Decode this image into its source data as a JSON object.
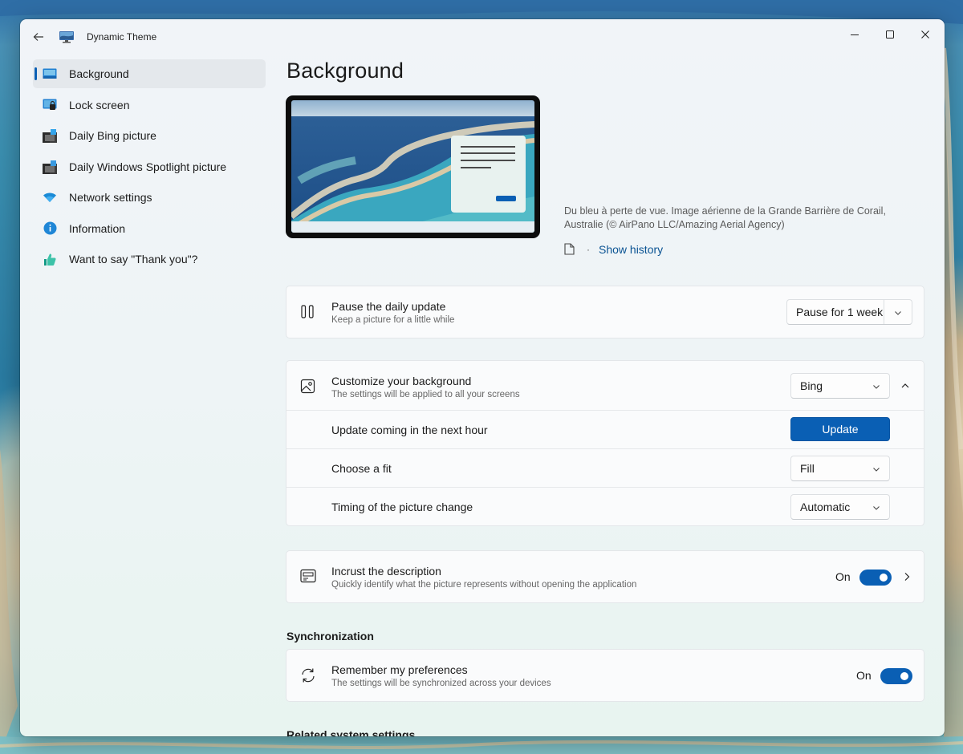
{
  "window": {
    "title": "Dynamic Theme",
    "back_icon": "back-arrow-icon",
    "app_icon": "monitor-app-icon"
  },
  "sidebar": {
    "items": [
      {
        "label": "Background",
        "icon": "background-icon",
        "active": true
      },
      {
        "label": "Lock screen",
        "icon": "lock-screen-icon",
        "active": false
      },
      {
        "label": "Daily Bing picture",
        "icon": "bing-picture-icon",
        "active": false
      },
      {
        "label": "Daily Windows Spotlight picture",
        "icon": "spotlight-picture-icon",
        "active": false
      },
      {
        "label": "Network settings",
        "icon": "wifi-icon",
        "active": false
      },
      {
        "label": "Information",
        "icon": "info-icon",
        "active": false
      },
      {
        "label": "Want to say \"Thank you\"?",
        "icon": "thumbs-up-icon",
        "active": false
      }
    ]
  },
  "page": {
    "title": "Background"
  },
  "preview": {
    "description": "Du bleu à perte de vue. Image aérienne de la Grande Barrière de Corail, Australie (© AirPano LLC/Amazing Aerial Agency)",
    "separator": "·",
    "history_link": "Show history"
  },
  "pause": {
    "title": "Pause the daily update",
    "subtitle": "Keep a picture for a little while",
    "dropdown_value": "Pause for 1 week"
  },
  "customize": {
    "title": "Customize your background",
    "subtitle": "The settings will be applied to all your screens",
    "source_value": "Bing",
    "update_text": "Update coming in the next hour",
    "update_button": "Update",
    "fit_label": "Choose a fit",
    "fit_value": "Fill",
    "timing_label": "Timing of the picture change",
    "timing_value": "Automatic"
  },
  "incrust": {
    "title": "Incrust the description",
    "subtitle": "Quickly identify what the picture represents without opening the application",
    "state_label": "On",
    "enabled": true
  },
  "sync": {
    "section_title": "Synchronization",
    "title": "Remember my preferences",
    "subtitle": "The settings will be synchronized across your devices",
    "state_label": "On",
    "enabled": true
  },
  "related": {
    "section_title": "Related system settings"
  },
  "colors": {
    "accent": "#0a5fb4",
    "window_bg": "#eef4f6",
    "card_bg": "#fafbfc"
  }
}
